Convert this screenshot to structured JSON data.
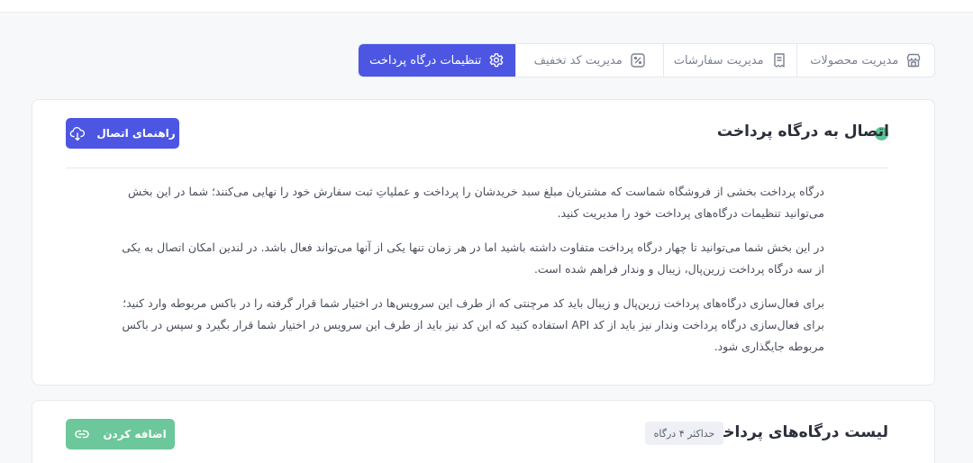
{
  "tabs": [
    {
      "label": "مدیریت محصولات",
      "icon": "store-icon"
    },
    {
      "label": "مدیریت سفارشات",
      "icon": "receipt-icon"
    },
    {
      "label": "مدیریت کد تخفیف",
      "icon": "percent-icon"
    },
    {
      "label": "تنظیمات درگاه پرداخت",
      "icon": "gear-icon",
      "active": true
    }
  ],
  "connection": {
    "title": "اتصال به درگاه پرداخت",
    "status_color": "#5cc493",
    "guide_button": "راهنمای اتصال",
    "paragraphs": [
      "درگاه پرداخت بخشی از فروشگاه شماست که مشتریان مبلغ سبد خریدشان را پرداخت و عملیاتِ ثبت سفارش خود را نهایی می‌کنند؛ شما در این بخش می‌توانید تنظیمات درگاه‌های پرداخت خود را مدیریت کنید.",
      "در این بخش شما می‌توانید تا چهار درگاه پرداخت متفاوت داشته باشید اما در هر زمان تنها یکی از آنها می‌تواند فعال باشد. در لندین امکان اتصال به یکی از سه درگاه پرداخت زرین‌پال، زیبال و وندار فراهم شده است.",
      "برای فعال‌سازی درگاه‌های پرداخت زرین‌پال و زیبال باید کد مرچنتی که از طرف این سرویس‌ها در اختیار شما قرار گرفته را در باکس مربوطه وارد کنید؛ برای فعال‌سازی درگاه پرداخت وندار نیز باید از کد API استفاده کنید که این کد نیز باید از طرف این سرویس در اختیار شما قرار بگیرد و سپس در باکس مربوطه جایگذاری شود."
    ]
  },
  "gateways": {
    "title": "لیست درگاه‌های پرداخت",
    "max_badge": "حداکثر ۴ درگاه",
    "add_button": "اضافه کردن"
  },
  "colors": {
    "primary": "#4c56e3",
    "success": "#6cc79a"
  }
}
